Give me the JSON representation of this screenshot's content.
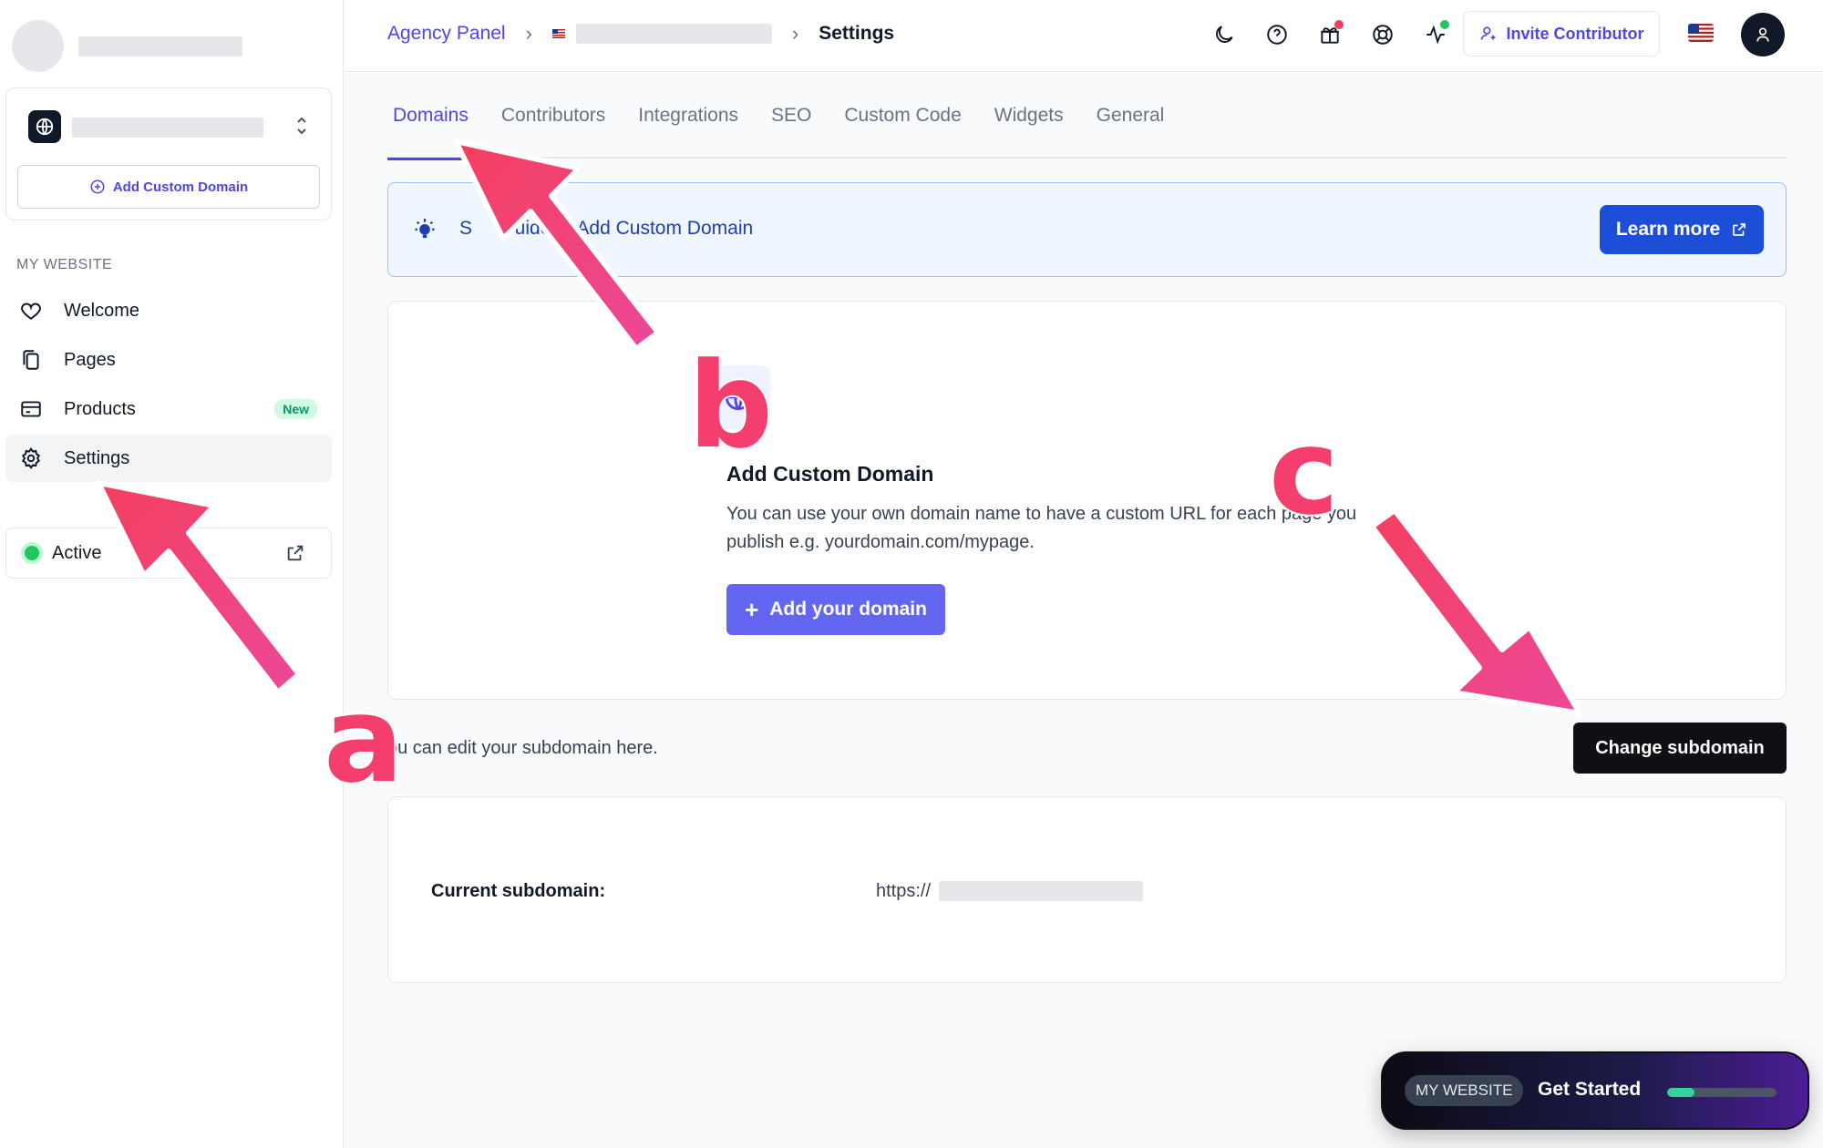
{
  "sidebar": {
    "add_custom_domain": "Add Custom Domain",
    "section_label": "MY WEBSITE",
    "items": [
      {
        "label": "Welcome",
        "icon": "heart-icon"
      },
      {
        "label": "Pages",
        "icon": "pages-icon"
      },
      {
        "label": "Products",
        "icon": "card-icon",
        "badge": "New"
      },
      {
        "label": "Settings",
        "icon": "gear-icon",
        "active": true
      }
    ],
    "status_label": "Active"
  },
  "topbar": {
    "crumb_root": "Agency Panel",
    "crumb_current": "Settings",
    "invite_label": "Invite Contributor"
  },
  "tabs": [
    "Domains",
    "Contributors",
    "Integrations",
    "SEO",
    "Custom Code",
    "Widgets",
    "General"
  ],
  "info": {
    "text": "S        uide to Add Custom Domain",
    "learn_more": "Learn more"
  },
  "domain_card": {
    "title": "Add Custom Domain",
    "description": "You can use your own domain name to have a custom URL for each page you publish e.g. yourdomain.com/mypage.",
    "add_button": "Add your domain"
  },
  "subdomain": {
    "edit_text": "ou can edit your subdomain here.",
    "change_button": "Change subdomain",
    "current_label": "Current subdomain:",
    "protocol": "https://"
  },
  "get_started": {
    "pill": "MY WEBSITE",
    "label": "Get Started",
    "progress": 0.25
  },
  "annotations": {
    "a": "a",
    "b": "b",
    "c": "c",
    "color": "#f43f6e"
  }
}
